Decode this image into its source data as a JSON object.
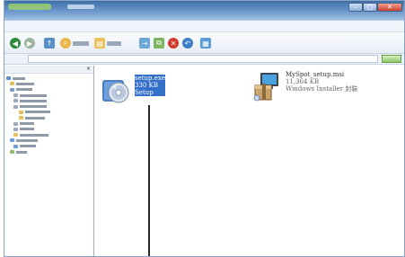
{
  "window": {
    "title": "",
    "controls": {
      "minimize": "–",
      "maximize": "□",
      "close": "✕"
    }
  },
  "menubar": {
    "items": []
  },
  "toolbar": {
    "buttons": []
  },
  "addressbar": {
    "label": "",
    "value": ""
  },
  "folder_pane": {
    "title": "",
    "close_glyph": "×",
    "items": [
      {
        "label": ""
      },
      {
        "label": ""
      },
      {
        "label": ""
      },
      {
        "label": ""
      },
      {
        "label": ""
      },
      {
        "label": ""
      },
      {
        "label": ""
      },
      {
        "label": ""
      },
      {
        "label": ""
      },
      {
        "label": ""
      },
      {
        "label": ""
      },
      {
        "label": ""
      },
      {
        "label": ""
      },
      {
        "label": ""
      },
      {
        "label": ""
      },
      {
        "label": ""
      },
      {
        "label": ""
      },
      {
        "label": ""
      }
    ]
  },
  "files": [
    {
      "name": "setup.exe",
      "size": "330 KB",
      "type": "Setup",
      "icon": "installer-cd-icon",
      "selected": true
    },
    {
      "name": "MySpot_setup.msi",
      "size": "11,364 KB",
      "type": "Windows Installer 封裝",
      "icon": "msi-package-icon",
      "selected": false
    }
  ],
  "colors": {
    "selection": "#3470c9",
    "titlebar": "#5b8ac0",
    "close_button": "#c9402b"
  }
}
